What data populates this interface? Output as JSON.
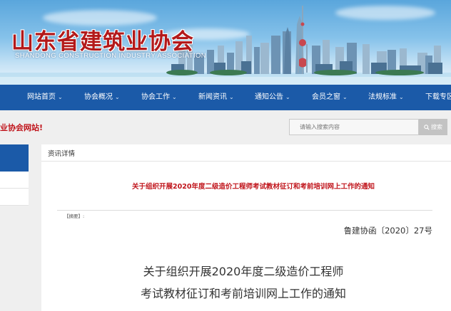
{
  "header": {
    "site_title": "山东省建筑业协会",
    "site_subtitle": "SHANDONG CONSTRUCTION INDUSTRY ASSOCIATION"
  },
  "nav": {
    "items": [
      {
        "label": "网站首页",
        "caret": "⌄"
      },
      {
        "label": "协会概况",
        "caret": "⌄"
      },
      {
        "label": "协会工作",
        "caret": "⌄"
      },
      {
        "label": "新闻资讯",
        "caret": "⌄"
      },
      {
        "label": "通知公告",
        "caret": "⌄"
      },
      {
        "label": "会员之窗",
        "caret": "⌄"
      },
      {
        "label": "法规标准",
        "caret": "⌄"
      },
      {
        "label": "下载专区",
        "caret": ""
      }
    ]
  },
  "notice": {
    "welcome_text": "业协会网站!"
  },
  "search": {
    "placeholder": "请输入搜索内容",
    "button_label": "搜索",
    "button_icon": "search-icon"
  },
  "main": {
    "section_label": "资讯详情",
    "article_title": "关于组织开展2020年度二级造价工程师考试教材征订和考前培训网上工作的通知",
    "summary_label": "【摘要】:",
    "doc_number": "鲁建协函〔2020〕27号",
    "doc_title_line1": "关于组织开展2020年度二级造价工程师",
    "doc_title_line2": "考试教材征订和考前培训网上工作的通知"
  },
  "colors": {
    "nav_bg": "#1b5aa8",
    "title_red": "#c0141b",
    "page_bg": "#efefef"
  }
}
